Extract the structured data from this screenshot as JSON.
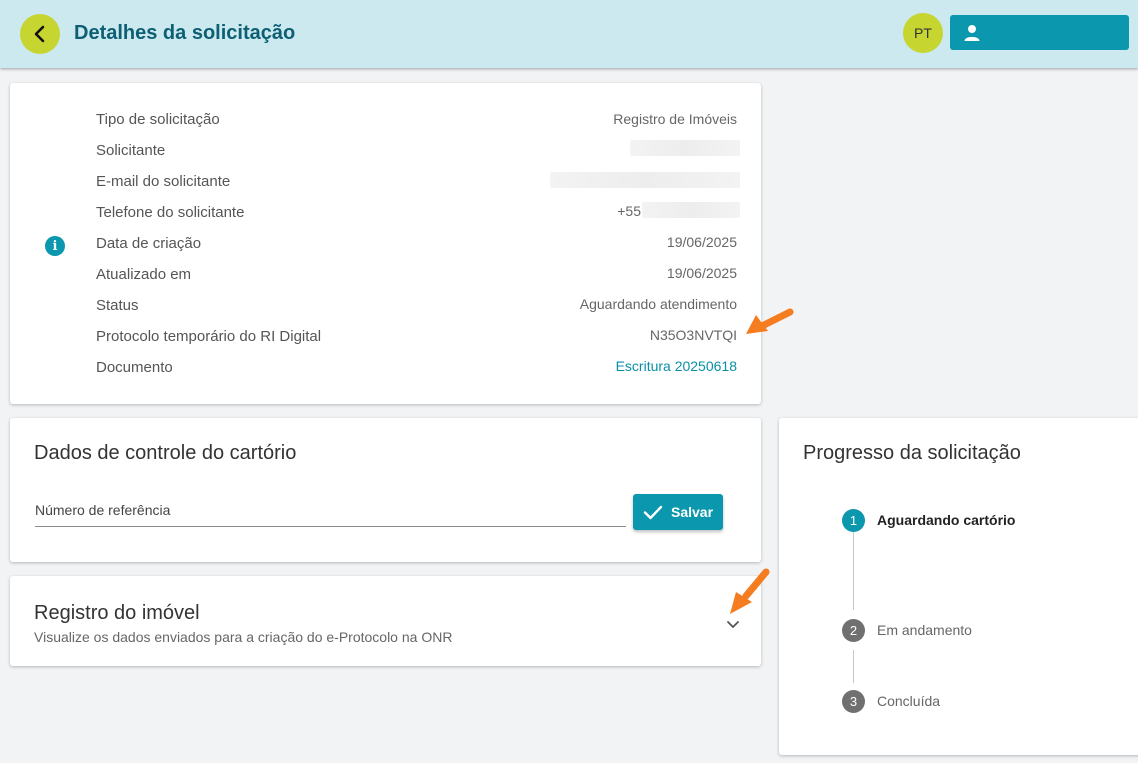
{
  "header": {
    "title": "Detalhes da solicitação",
    "avatar_initials": "PT",
    "user_button_label": ""
  },
  "info": {
    "rows": [
      {
        "label": "Tipo de solicitação",
        "value": "Registro de Imóveis"
      },
      {
        "label": "Solicitante",
        "value": ""
      },
      {
        "label": "E-mail do solicitante",
        "value": ""
      },
      {
        "label": "Telefone do solicitante",
        "value": "+55"
      },
      {
        "label": "Data de criação",
        "value": "19/06/2025"
      },
      {
        "label": "Atualizado em",
        "value": "19/06/2025"
      },
      {
        "label": "Status",
        "value": "Aguardando atendimento"
      },
      {
        "label": "Protocolo temporário do RI Digital",
        "value": "N35O3NVTQI"
      },
      {
        "label": "Documento",
        "value": "Escritura 20250618"
      }
    ]
  },
  "control": {
    "title": "Dados de controle do cartório",
    "reference_label": "Número de referência",
    "save_label": "Salvar"
  },
  "registro": {
    "title": "Registro do imóvel",
    "subtitle": "Visualize os dados enviados para a criação do e-Protocolo na ONR"
  },
  "progress": {
    "title": "Progresso da solicitação",
    "steps": [
      {
        "number": "1",
        "label": "Aguardando cartório",
        "active": true
      },
      {
        "number": "2",
        "label": "Em andamento",
        "active": false
      },
      {
        "number": "3",
        "label": "Concluída",
        "active": false
      }
    ]
  },
  "colors": {
    "header_bg": "#cbe9ef",
    "accent": "#0b97ad",
    "lime": "#c6d530",
    "annotation_arrow": "#f57c1f"
  }
}
